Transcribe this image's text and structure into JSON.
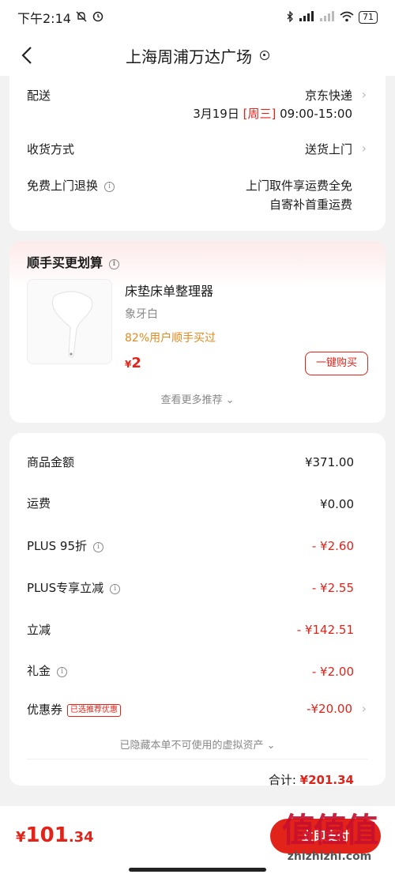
{
  "status": {
    "time": "下午2:14",
    "battery": "71"
  },
  "nav": {
    "title": "上海周浦万达广场"
  },
  "delivery": {
    "shipping_label": "配送",
    "shipping_value": "京东快递",
    "date": "3月19日",
    "weekday": "[周三]",
    "time_range": "09:00-15:00",
    "receive_label": "收货方式",
    "receive_value": "送货上门",
    "return_label": "免费上门退换",
    "return_line1": "上门取件享运费全免",
    "return_line2": "自寄补首重运费"
  },
  "upsell": {
    "title": "顺手买更划算",
    "product_name": "床垫床单整理器",
    "variant": "象牙白",
    "stat": "82%用户顺手买过",
    "currency": "¥",
    "price": "2",
    "buy_label": "一键购买",
    "more_label": "查看更多推荐"
  },
  "summary": {
    "rows": [
      {
        "label": "商品金额",
        "value": "¥371.00"
      },
      {
        "label": "运费",
        "value": "¥0.00"
      },
      {
        "label": "PLUS 95折",
        "value": "- ¥2.60"
      },
      {
        "label": "PLUS专享立减",
        "value": "- ¥2.55"
      },
      {
        "label": "立减",
        "value": "- ¥142.51"
      },
      {
        "label": "礼金",
        "value": "- ¥2.00"
      },
      {
        "label": "优惠券",
        "value": "-¥20.00"
      }
    ],
    "coupon_tag": "已选推荐优惠",
    "hidden_note": "已隐藏本单不可使用的虚拟资产",
    "total_label": "合计:",
    "total_value": "¥201.34"
  },
  "bottom": {
    "currency": "¥",
    "int": "101",
    "dec": ".34",
    "pay_label": "立即支付",
    "watermark_big": "值值值",
    "watermark_url": "zhizhizhi.com"
  },
  "colors": {
    "accent": "#e2231a",
    "orange": "#e38a1f",
    "background": "#f2f2f2"
  }
}
